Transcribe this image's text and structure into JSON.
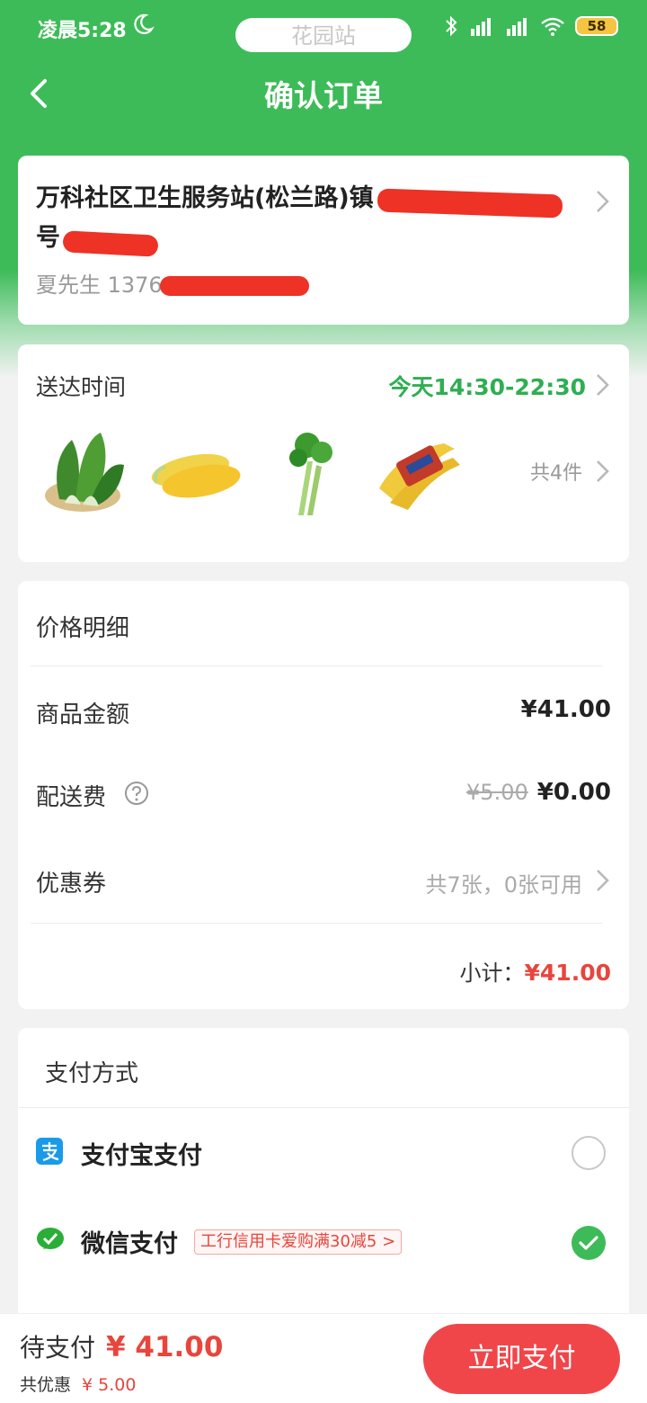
{
  "status_bar": {
    "time": "凌晨5:28",
    "station": "花园站",
    "battery": "58"
  },
  "header": {
    "title": "确认订单"
  },
  "address": {
    "line": "万科社区卫生服务站(松兰路)镇",
    "line2": "号",
    "contact": "夏先生 1376"
  },
  "delivery": {
    "label": "送达时间",
    "time": "今天14:30-22:30",
    "count": "共4件",
    "items": [
      "bok-choy",
      "corn",
      "celery",
      "banana"
    ]
  },
  "price": {
    "title": "价格明细",
    "goods_label": "商品金额",
    "goods_value": "¥41.00",
    "delivery_label": "配送费",
    "delivery_original": "¥5.00",
    "delivery_value": "¥0.00",
    "coupon_label": "优惠券",
    "coupon_value": "共7张，0张可用",
    "subtotal_label": "小计：",
    "subtotal_value": "¥41.00"
  },
  "payment": {
    "title": "支付方式",
    "methods": [
      {
        "name": "支付宝支付",
        "selected": false
      },
      {
        "name": "微信支付",
        "promo": "工行信用卡爱购满30减5 >",
        "selected": true
      }
    ]
  },
  "footer": {
    "pending_label": "待支付",
    "pending_value": "¥ 41.00",
    "discount_label": "共优惠",
    "discount_value": "¥ 5.00",
    "pay_button": "立即支付"
  },
  "colors": {
    "brand_green": "#3dbb58",
    "accent_red": "#e8453c",
    "button_red": "#f0464a"
  }
}
